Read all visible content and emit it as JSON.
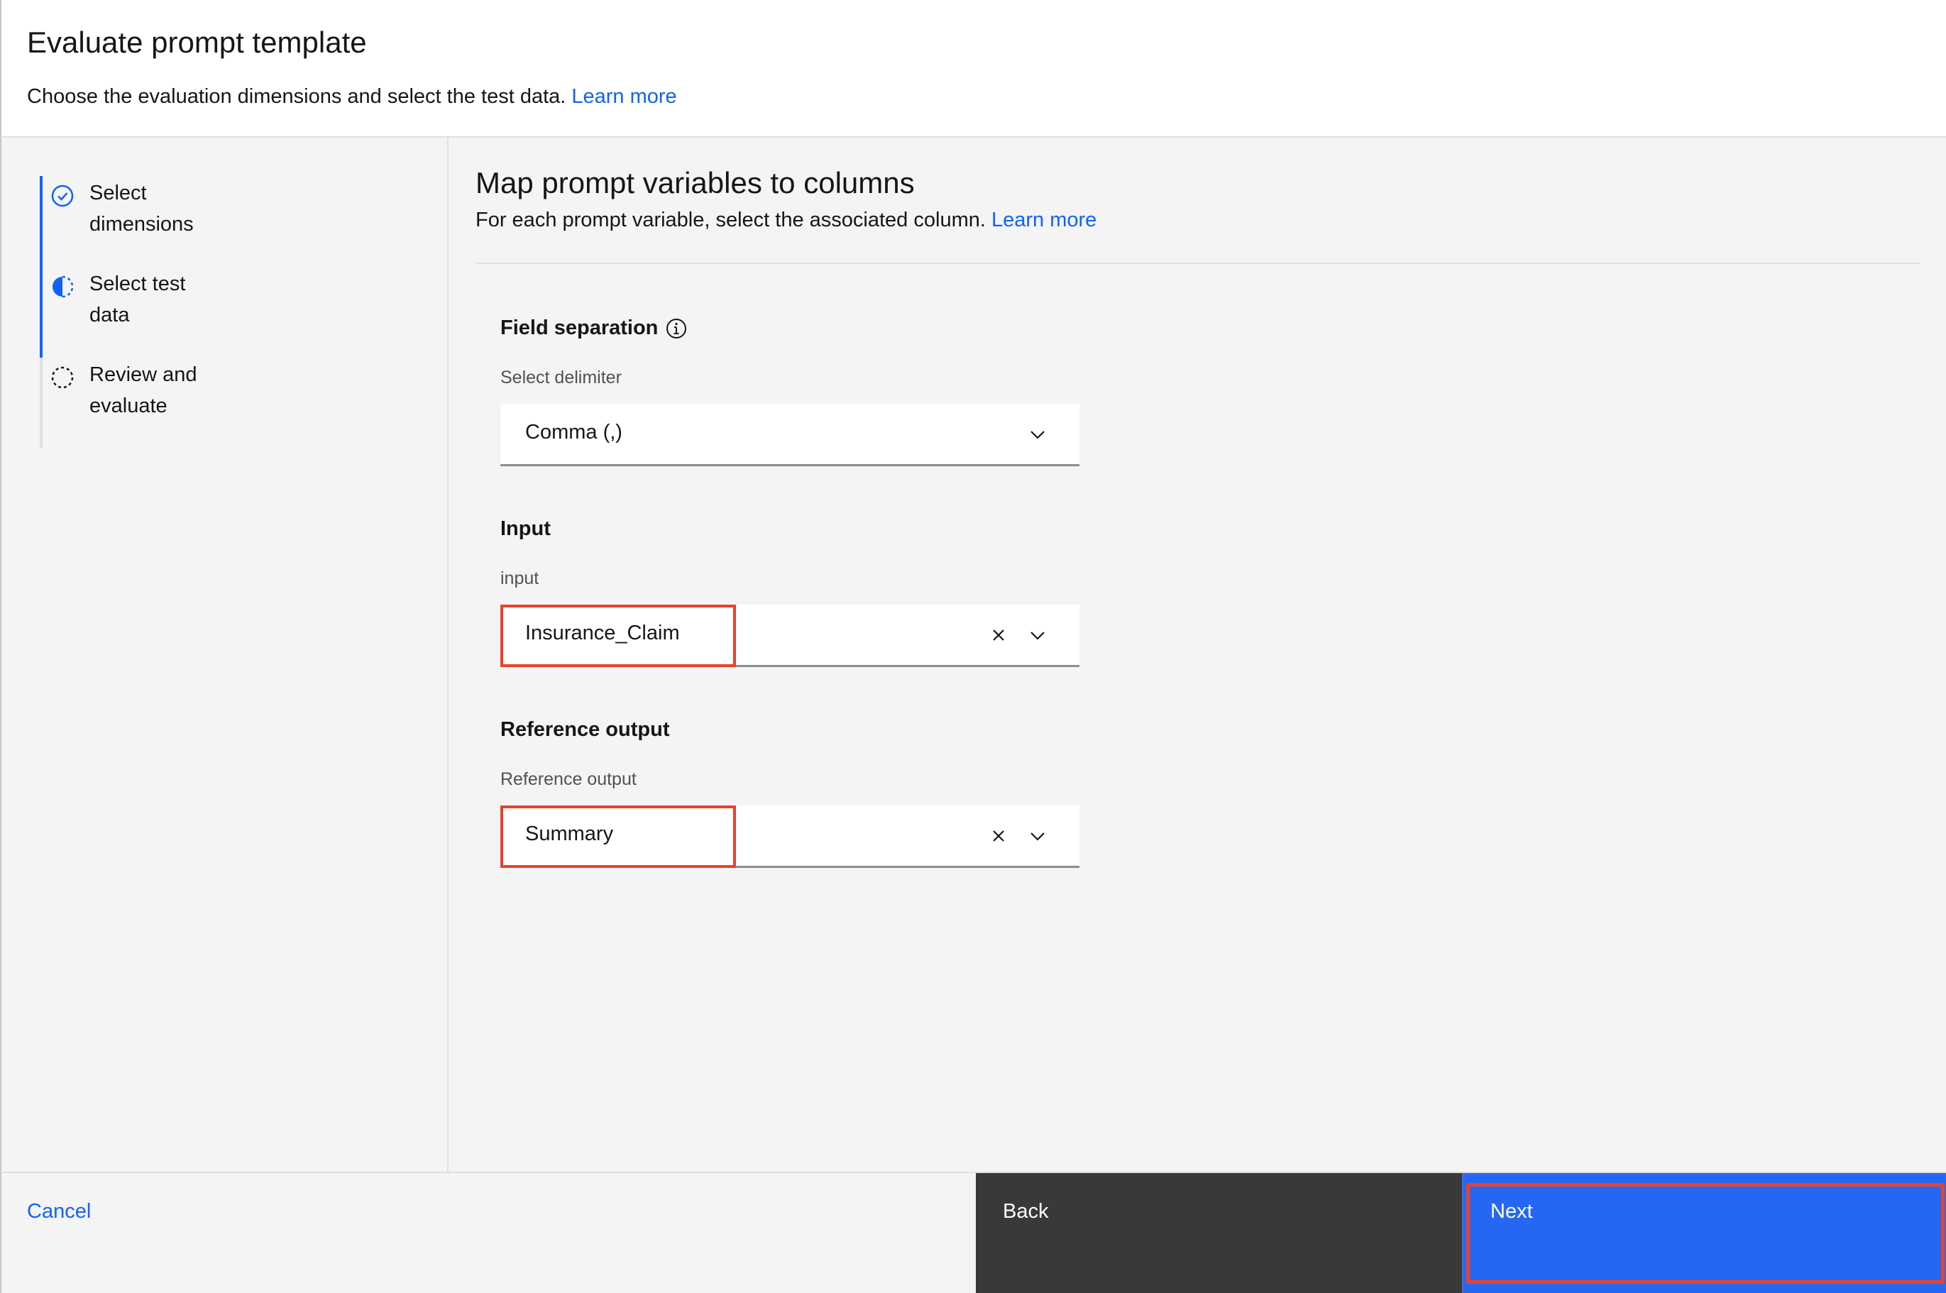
{
  "header": {
    "title": "Evaluate prompt template",
    "subtitle": "Choose the evaluation dimensions and select the test data.",
    "learn_more": "Learn more"
  },
  "progress": {
    "steps": [
      {
        "label_line1": "Select",
        "label_line2": "dimensions",
        "state": "complete",
        "icon": "checkmark-circle-icon"
      },
      {
        "label_line1": "Select test",
        "label_line2": "data",
        "state": "current",
        "icon": "half-filled-circle-icon"
      },
      {
        "label_line1": "Review and",
        "label_line2": "evaluate",
        "state": "incomplete",
        "icon": "dashed-circle-icon"
      }
    ]
  },
  "main": {
    "title": "Map prompt variables to columns",
    "description": "For each prompt variable, select the associated column.",
    "learn_more": "Learn more",
    "field_separation": {
      "heading": "Field separation",
      "info_icon": "information-icon",
      "label": "Select delimiter",
      "value": "Comma (,)"
    },
    "input": {
      "heading": "Input",
      "label": "input",
      "value": "Insurance_Claim"
    },
    "reference_output": {
      "heading": "Reference output",
      "label": "Reference output",
      "value": "Summary"
    }
  },
  "footer": {
    "cancel": "Cancel",
    "back": "Back",
    "next": "Next"
  },
  "colors": {
    "accent": "#0f62fe",
    "primary_button": "#2567f3",
    "secondary_button": "#393939",
    "highlight": "#e8422a"
  }
}
